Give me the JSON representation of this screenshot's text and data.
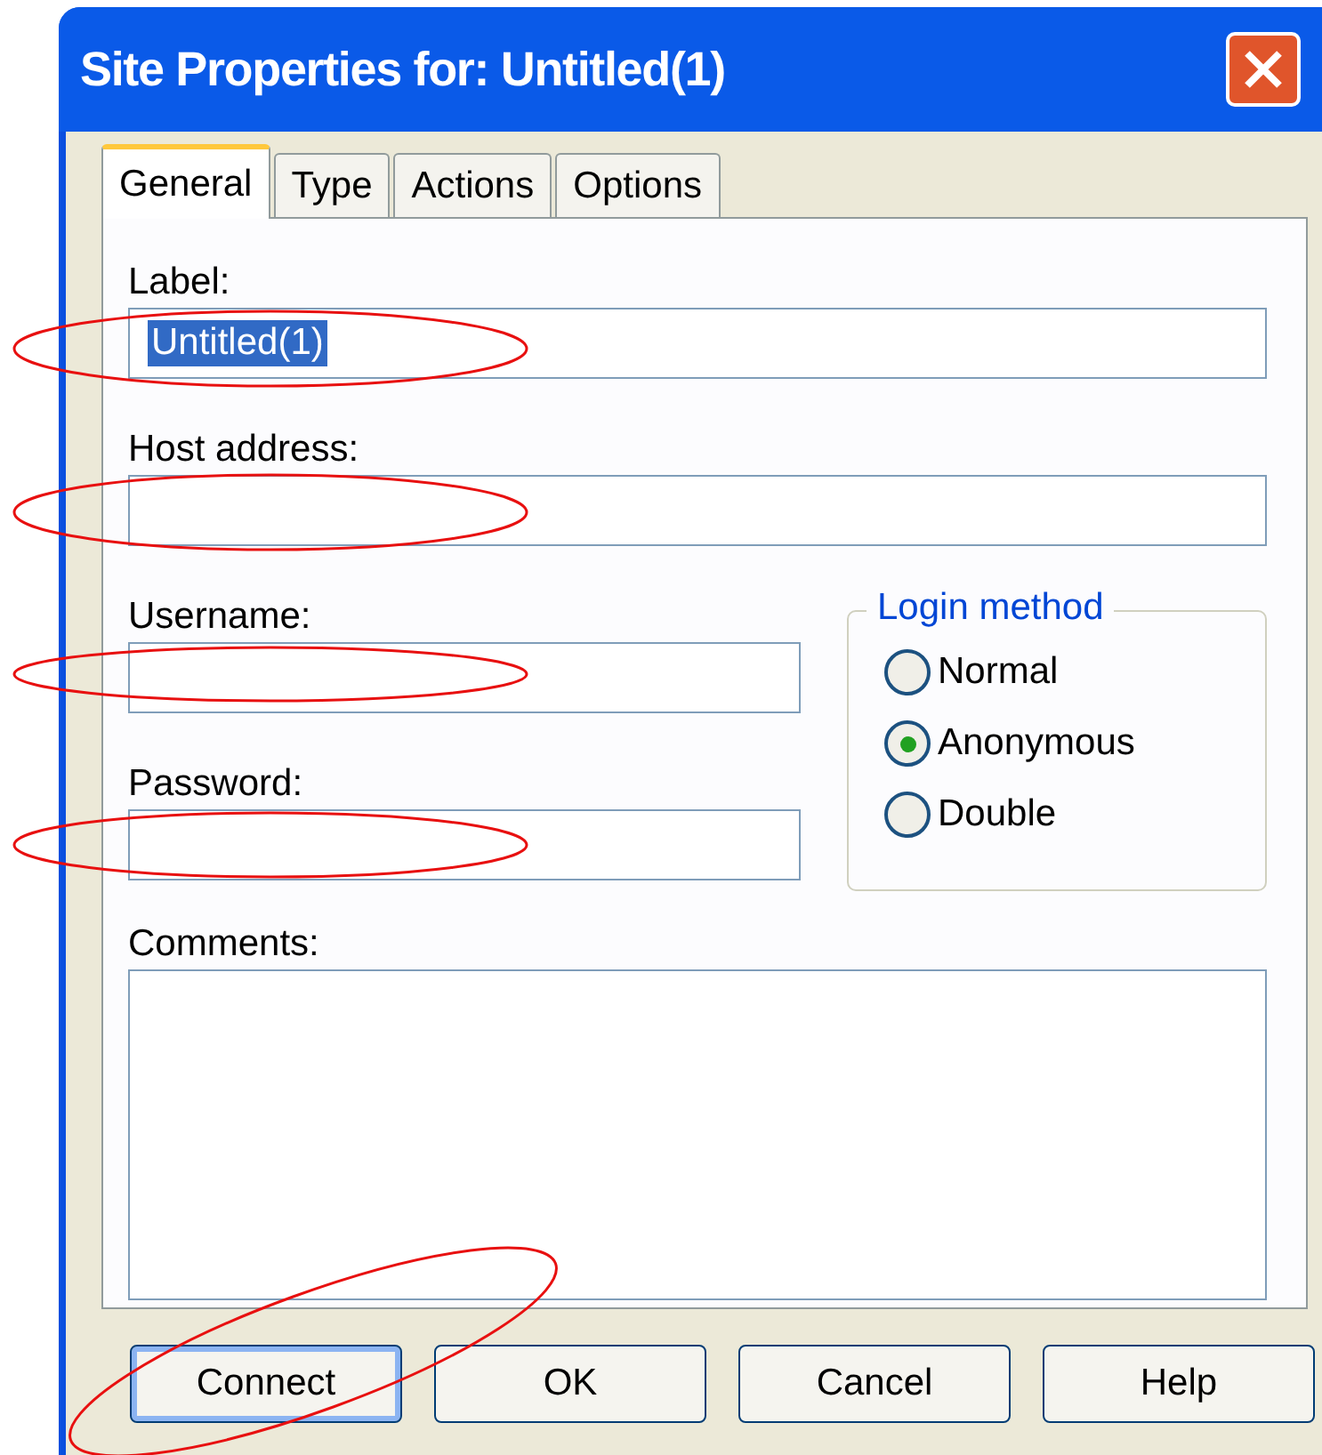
{
  "window": {
    "title": "Site Properties for: Untitled(1)"
  },
  "tabs": [
    {
      "label": "General",
      "selected": true
    },
    {
      "label": "Type",
      "selected": false
    },
    {
      "label": "Actions",
      "selected": false
    },
    {
      "label": "Options",
      "selected": false
    }
  ],
  "label_field": {
    "label": "Label:",
    "value": "Untitled(1)",
    "text_selected": true
  },
  "host_field": {
    "label": "Host address:"
  },
  "username_field": {
    "label": "Username:"
  },
  "password_field": {
    "label": "Password:"
  },
  "login_method": {
    "title": "Login method",
    "options": [
      {
        "label": "Normal",
        "selected": false
      },
      {
        "label": "Anonymous",
        "selected": true
      },
      {
        "label": "Double",
        "selected": false
      }
    ]
  },
  "comments": {
    "label": "Comments:"
  },
  "buttons": [
    {
      "label": "Connect",
      "default": true
    },
    {
      "label": "OK",
      "default": false
    },
    {
      "label": "Cancel",
      "default": false
    },
    {
      "label": "Help",
      "default": false
    }
  ]
}
